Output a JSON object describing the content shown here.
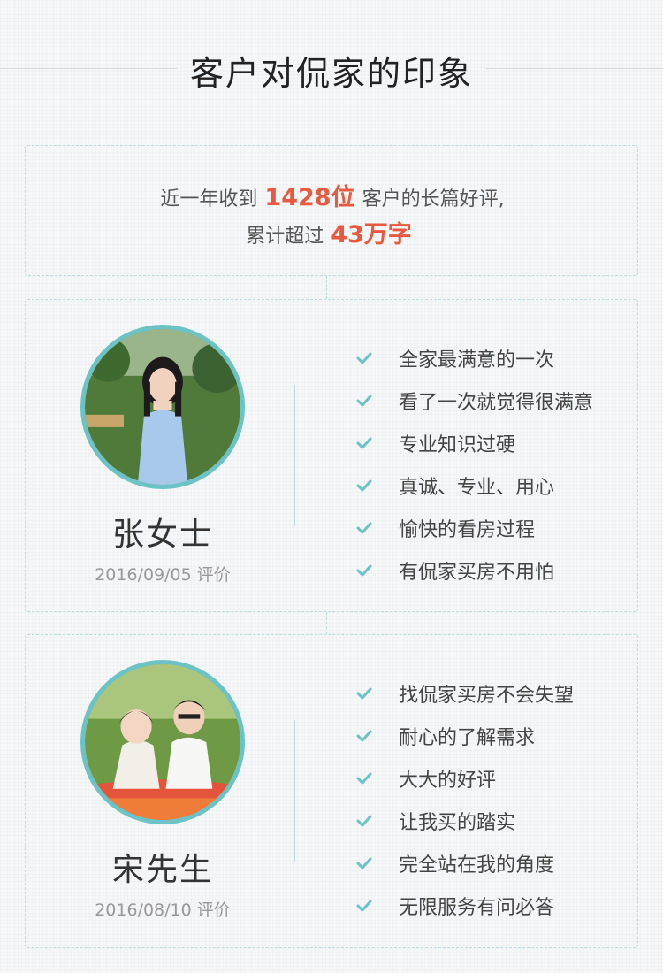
{
  "header": {
    "title": "客户对侃家的印象"
  },
  "summary": {
    "line1_prefix": "近一年收到",
    "line1_highlight": "1428位",
    "line1_suffix": "客户的长篇好评,",
    "line2_prefix": "累计超过",
    "line2_highlight": "43万字"
  },
  "colors": {
    "accent": "#6cc3c5",
    "highlight": "#e85a3f",
    "dashed_border": "#b7dfe0"
  },
  "reviews": [
    {
      "name": "张女士",
      "date": "2016/09/05 评价",
      "avatar_icon": "customer-photo-woman",
      "tags": [
        "全家最满意的一次",
        "看了一次就觉得很满意",
        "专业知识过硬",
        "真诚、专业、用心",
        "愉快的看房过程",
        "有侃家买房不用怕"
      ]
    },
    {
      "name": "宋先生",
      "date": "2016/08/10 评价",
      "avatar_icon": "customer-photo-couple",
      "tags": [
        "找侃家买房不会失望",
        "耐心的了解需求",
        "大大的好评",
        "让我买的踏实",
        "完全站在我的角度",
        "无限服务有问必答"
      ]
    }
  ]
}
